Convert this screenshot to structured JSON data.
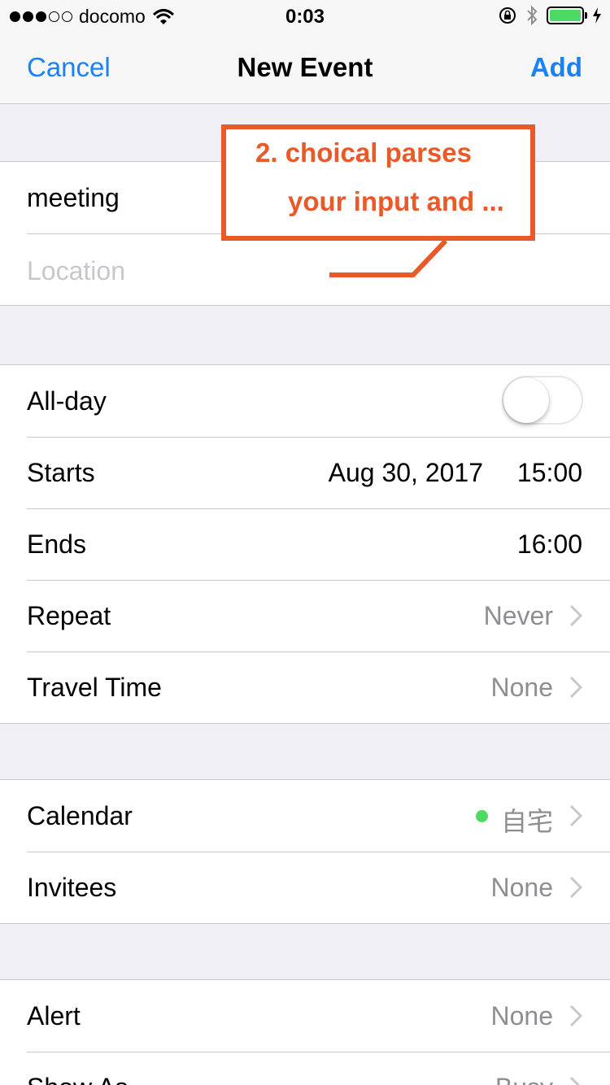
{
  "status_bar": {
    "carrier": "docomo",
    "time": "0:03"
  },
  "nav": {
    "cancel_label": "Cancel",
    "title": "New Event",
    "add_label": "Add"
  },
  "event": {
    "title_value": "meeting",
    "location_placeholder": "Location"
  },
  "schedule": {
    "all_day_label": "All-day",
    "all_day_on": false,
    "starts_label": "Starts",
    "starts_date": "Aug 30, 2017",
    "starts_time": "15:00",
    "ends_label": "Ends",
    "ends_time": "16:00",
    "repeat_label": "Repeat",
    "repeat_value": "Never",
    "travel_label": "Travel Time",
    "travel_value": "None"
  },
  "calendar_group": {
    "calendar_label": "Calendar",
    "calendar_value": "自宅",
    "calendar_color": "#4cd964",
    "invitees_label": "Invitees",
    "invitees_value": "None"
  },
  "alert_group": {
    "alert_label": "Alert",
    "alert_value": "None",
    "show_as_label": "Show As",
    "show_as_value": "Busy"
  },
  "callout": {
    "line1": "2. choical parses",
    "line2": "your input and ...",
    "color": "#ea5a28"
  },
  "colors": {
    "accent": "#1a82f7",
    "background": "#efeff4",
    "secondary_text": "#8e8e93",
    "battery": "#4cd964"
  }
}
